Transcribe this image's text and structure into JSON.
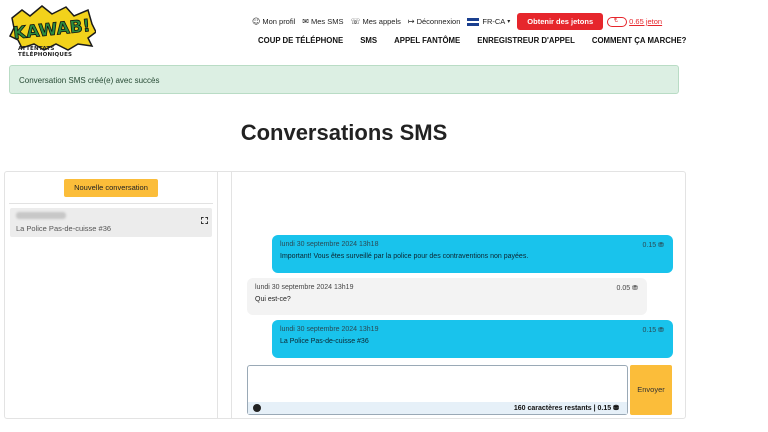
{
  "brand": {
    "logo_text": "KAWAB!",
    "tagline": "ATTENTATS TÉLÉPHONIQUES",
    "colors": {
      "accent": "#e6262c",
      "yellow": "#fbbd3a",
      "bubble": "#19c3ec",
      "alert_bg": "#dcefe3"
    }
  },
  "util_nav": {
    "profile": {
      "icon": "user-icon",
      "label": "Mon profil"
    },
    "sms": {
      "icon": "chat-icon",
      "label": "Mes SMS"
    },
    "calls": {
      "icon": "phone-icon",
      "label": "Mes appels"
    },
    "logout": {
      "icon": "logout-icon",
      "label": "Déconnexion"
    },
    "lang": {
      "icon": "flag-icon",
      "label": "FR-CA"
    },
    "tokens_button": "Obtenir des jetons",
    "balance": "0.65 jeton"
  },
  "main_nav": [
    "COUP DE TÉLÉPHONE",
    "SMS",
    "APPEL FANTÔME",
    "ENREGISTREUR D'APPEL",
    "COMMENT ÇA MARCHE?"
  ],
  "alert": {
    "message": "Conversation SMS créé(e) avec succès"
  },
  "page_title": "Conversations SMS",
  "sidebar": {
    "new_conversation": "Nouvelle conversation",
    "conversations": [
      {
        "subtitle": "La Police Pas-de-cuisse #36"
      }
    ]
  },
  "messages": [
    {
      "direction": "sent",
      "timestamp": "lundi 30 septembre 2024 13h18",
      "cost": "0.15",
      "text": "Important! Vous êtes surveillé par la police pour des contraventions non payées."
    },
    {
      "direction": "received",
      "timestamp": "lundi 30 septembre 2024 13h19",
      "cost": "0.05",
      "text": "Qui est-ce?"
    },
    {
      "direction": "sent",
      "timestamp": "lundi 30 septembre 2024 13h19",
      "cost": "0.15",
      "text": "La Police Pas-de-cuisse #36"
    }
  ],
  "composer": {
    "value": "",
    "counter": "160 caractères restants | 0.15",
    "send_label": "Envoyer"
  }
}
